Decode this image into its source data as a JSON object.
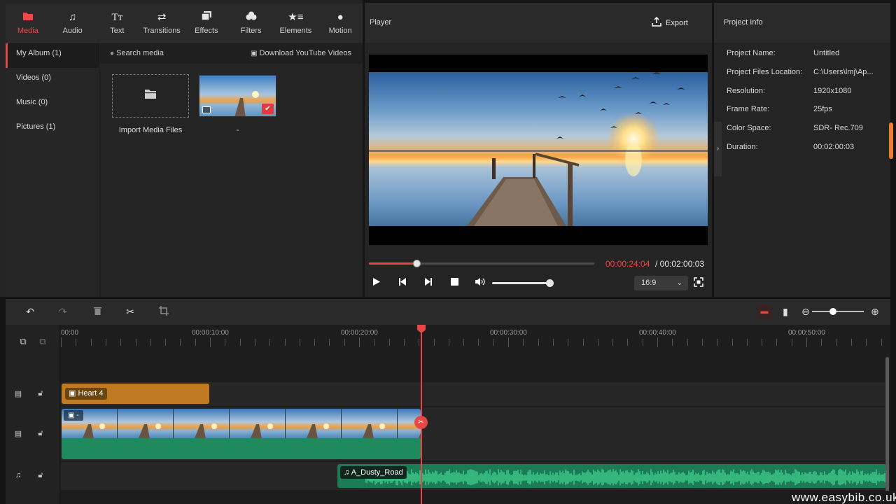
{
  "toolbar": {
    "tabs": [
      {
        "label": "Media",
        "icon": "folder-icon"
      },
      {
        "label": "Audio",
        "icon": "music-note-icon"
      },
      {
        "label": "Text",
        "icon": "text-icon"
      },
      {
        "label": "Transitions",
        "icon": "transitions-icon"
      },
      {
        "label": "Effects",
        "icon": "effects-icon"
      },
      {
        "label": "Filters",
        "icon": "filters-icon"
      },
      {
        "label": "Elements",
        "icon": "elements-icon"
      },
      {
        "label": "Motion",
        "icon": "motion-icon"
      }
    ],
    "active": "Media",
    "accent": "#f04848"
  },
  "album": {
    "items": [
      {
        "label": "My Album (1)"
      },
      {
        "label": "Videos (0)"
      },
      {
        "label": "Music (0)"
      },
      {
        "label": "Pictures (1)"
      }
    ]
  },
  "media": {
    "search_label": "Search media",
    "youtube_label": "Download YouTube Videos",
    "import_label": "Import Media Files",
    "thumb_label": "-"
  },
  "player": {
    "title": "Player",
    "export_label": "Export",
    "time_current": "00:00:24:04",
    "time_total": "/ 00:02:00:03",
    "progress": 0.21,
    "volume": 0.92,
    "aspect_ratio": "16:9"
  },
  "project_info": {
    "title": "Project Info",
    "rows": [
      {
        "key": "Project Name:",
        "value": "Untitled"
      },
      {
        "key": "Project Files Location:",
        "value": "C:\\Users\\lmj\\Ap..."
      },
      {
        "key": "Resolution:",
        "value": "1920x1080"
      },
      {
        "key": "Frame Rate:",
        "value": "25fps"
      },
      {
        "key": "Color Space:",
        "value": "SDR- Rec.709"
      },
      {
        "key": "Duration:",
        "value": "00:02:00:03"
      }
    ]
  },
  "timeline": {
    "ruler": [
      "00:00",
      "00:00:10:00",
      "00:00:20:00",
      "00:00:30:00",
      "00:00:40:00",
      "00:00:50:00"
    ],
    "heart_clip": "Heart 4",
    "video_clip": "-",
    "audio_clip": "A_Dusty_Road",
    "zoom": 0.4,
    "playhead_color": "#e84545",
    "audio_color": "#1e8a5e",
    "overlay_color": "#c07a21"
  },
  "watermark": "www.easybib.co.uk"
}
